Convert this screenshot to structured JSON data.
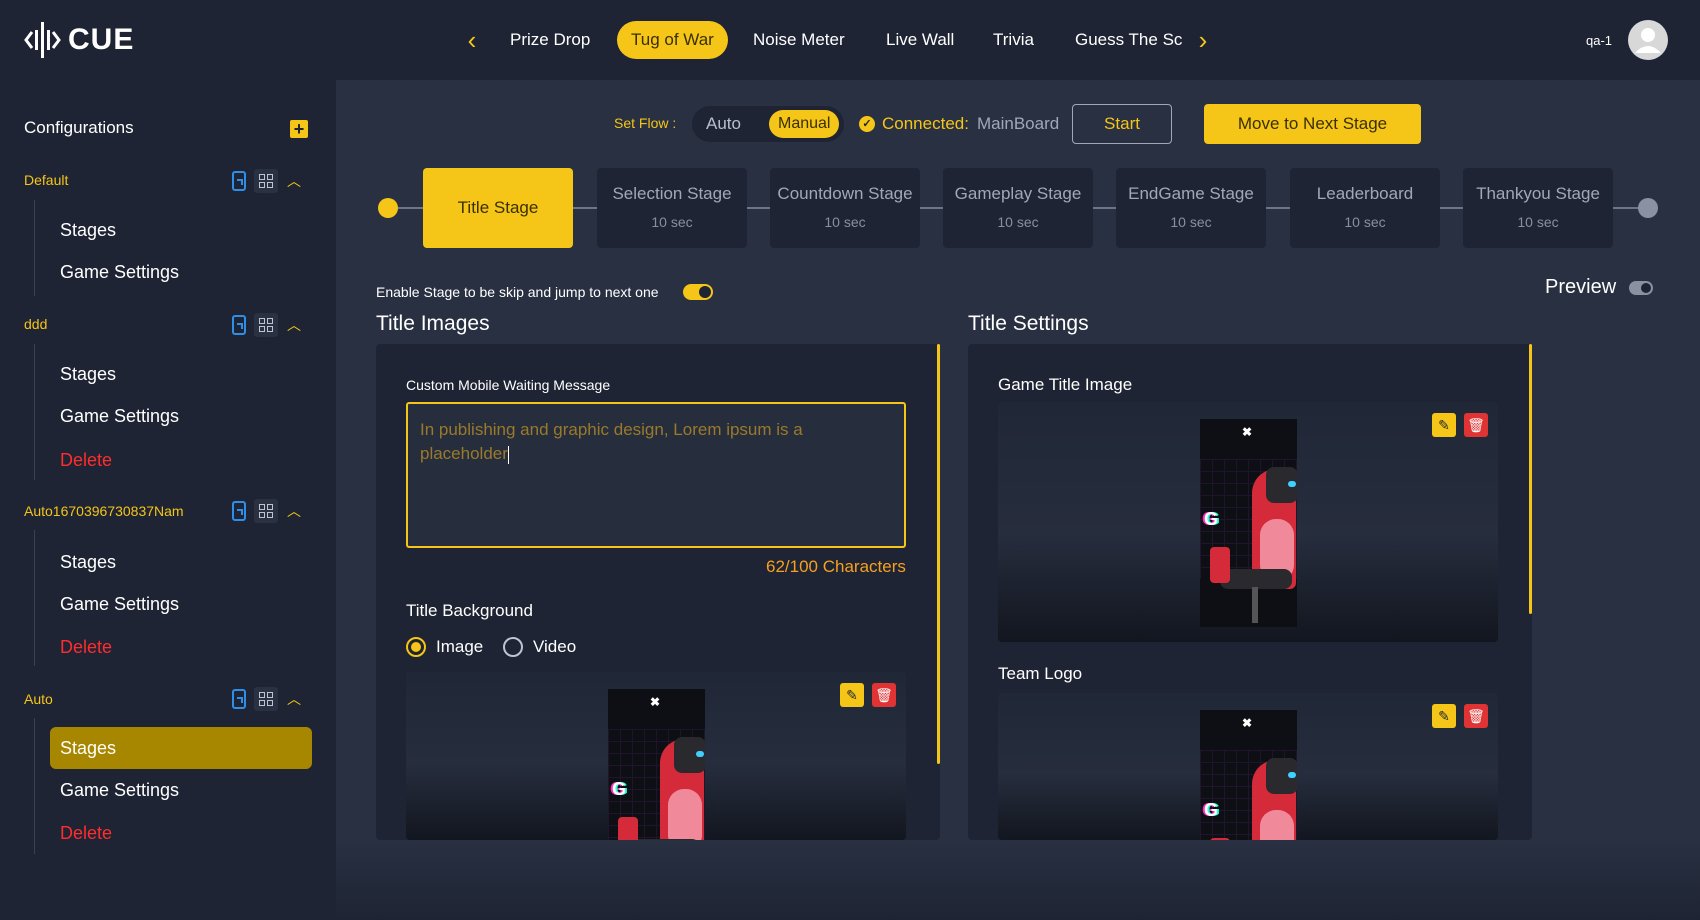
{
  "header": {
    "logo_text": "CUE",
    "nav_tabs": [
      "Prize Drop",
      "Tug of War",
      "Noise Meter",
      "Live Wall",
      "Trivia",
      "Guess The Sc"
    ],
    "active_tab": "Tug of War",
    "user_name": "qa-1",
    "icons": {
      "prev": "chevron-left-icon",
      "next": "chevron-right-icon",
      "avatar": "user-avatar-icon"
    },
    "accent_color": "#f5c518"
  },
  "sidebar": {
    "title": "Configurations",
    "groups": [
      {
        "name": "Default",
        "items": [
          "Stages",
          "Game Settings"
        ]
      },
      {
        "name": "ddd",
        "items": [
          "Stages",
          "Game Settings",
          "Delete"
        ]
      },
      {
        "name": "Auto1670396730837Nam",
        "items": [
          "Stages",
          "Game Settings",
          "Delete"
        ]
      },
      {
        "name": "Auto",
        "items": [
          "Stages",
          "Game Settings",
          "Delete"
        ],
        "active_item": "Stages"
      }
    ]
  },
  "flow": {
    "label": "Set Flow :",
    "options": [
      "Auto",
      "Manual"
    ],
    "selected": "Manual",
    "connected_label": "Connected:",
    "connected_value": "MainBoard",
    "start_label": "Start",
    "next_stage_label": "Move to Next Stage"
  },
  "stages": [
    {
      "name": "Title Stage",
      "duration": ""
    },
    {
      "name": "Selection Stage",
      "duration": "10 sec"
    },
    {
      "name": "Countdown Stage",
      "duration": "10 sec"
    },
    {
      "name": "Gameplay Stage",
      "duration": "10 sec"
    },
    {
      "name": "EndGame Stage",
      "duration": "10 sec"
    },
    {
      "name": "Leaderboard",
      "duration": "10 sec"
    },
    {
      "name": "Thankyou Stage",
      "duration": "10 sec"
    }
  ],
  "skip_toggle_label": "Enable Stage to be skip and jump to next one",
  "skip_toggle_on": true,
  "preview_label": "Preview",
  "preview_on": false,
  "title_images": {
    "heading": "Title Images",
    "message_label": "Custom Mobile Waiting Message",
    "message_value": "In publishing and graphic design, Lorem ipsum is a placeholder",
    "char_count": "62/100 Characters",
    "background_label": "Title Background",
    "background_options": [
      "Image",
      "Video"
    ],
    "background_selected": "Image"
  },
  "title_settings": {
    "heading": "Title Settings",
    "game_title_image_label": "Game Title Image",
    "team_logo_label": "Team Logo"
  }
}
